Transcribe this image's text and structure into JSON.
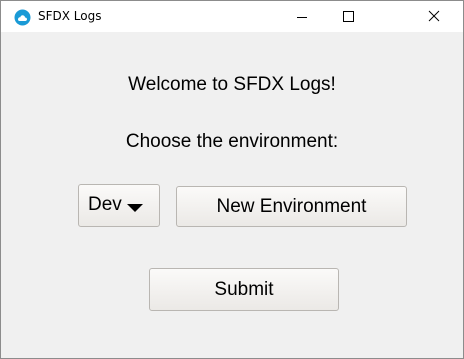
{
  "window": {
    "title": "SFDX Logs",
    "app_icon": "sfdx-cloud-icon",
    "controls": {
      "minimize_icon": "minimize-icon",
      "maximize_icon": "maximize-icon",
      "close_icon": "close-icon"
    }
  },
  "main": {
    "welcome_text": "Welcome to SFDX Logs!",
    "prompt_text": "Choose the environment:",
    "environment_select": {
      "selected": "Dev",
      "caret_icon": "caret-down-icon"
    },
    "new_environment_label": "New Environment",
    "submit_label": "Submit"
  },
  "colors": {
    "titlebar": "#ffffff",
    "window_background": "#f0f0f0",
    "app_icon_blue": "#1a9ad6"
  }
}
